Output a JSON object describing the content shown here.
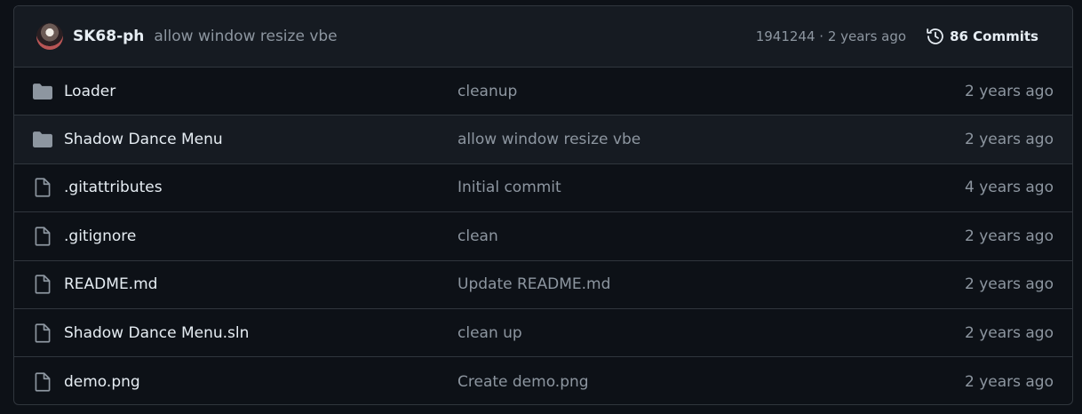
{
  "latest_commit": {
    "author": "SK68-ph",
    "message": "allow window resize vbe",
    "meta": "1941244 · 2 years ago",
    "commits_label": "86 Commits"
  },
  "files": [
    {
      "type": "folder",
      "icon": "folder-icon",
      "name": "Loader",
      "message": "cleanup",
      "age": "2 years ago"
    },
    {
      "type": "folder",
      "icon": "folder-icon",
      "name": "Shadow Dance Menu",
      "message": "allow window resize vbe",
      "age": "2 years ago"
    },
    {
      "type": "file",
      "icon": "file-icon",
      "name": ".gitattributes",
      "message": "Initial commit",
      "age": "4 years ago"
    },
    {
      "type": "file",
      "icon": "file-icon",
      "name": ".gitignore",
      "message": "clean",
      "age": "2 years ago"
    },
    {
      "type": "file",
      "icon": "file-icon",
      "name": "README.md",
      "message": "Update README.md",
      "age": "2 years ago"
    },
    {
      "type": "file",
      "icon": "file-icon",
      "name": "Shadow Dance Menu.sln",
      "message": "clean up",
      "age": "2 years ago"
    },
    {
      "type": "file",
      "icon": "file-icon",
      "name": "demo.png",
      "message": "Create demo.png",
      "age": "2 years ago"
    }
  ],
  "colors": {
    "background": "#0d1117",
    "header_bg": "#161b22",
    "border": "#30363d",
    "text": "#e6edf3",
    "muted": "#8d96a0"
  }
}
